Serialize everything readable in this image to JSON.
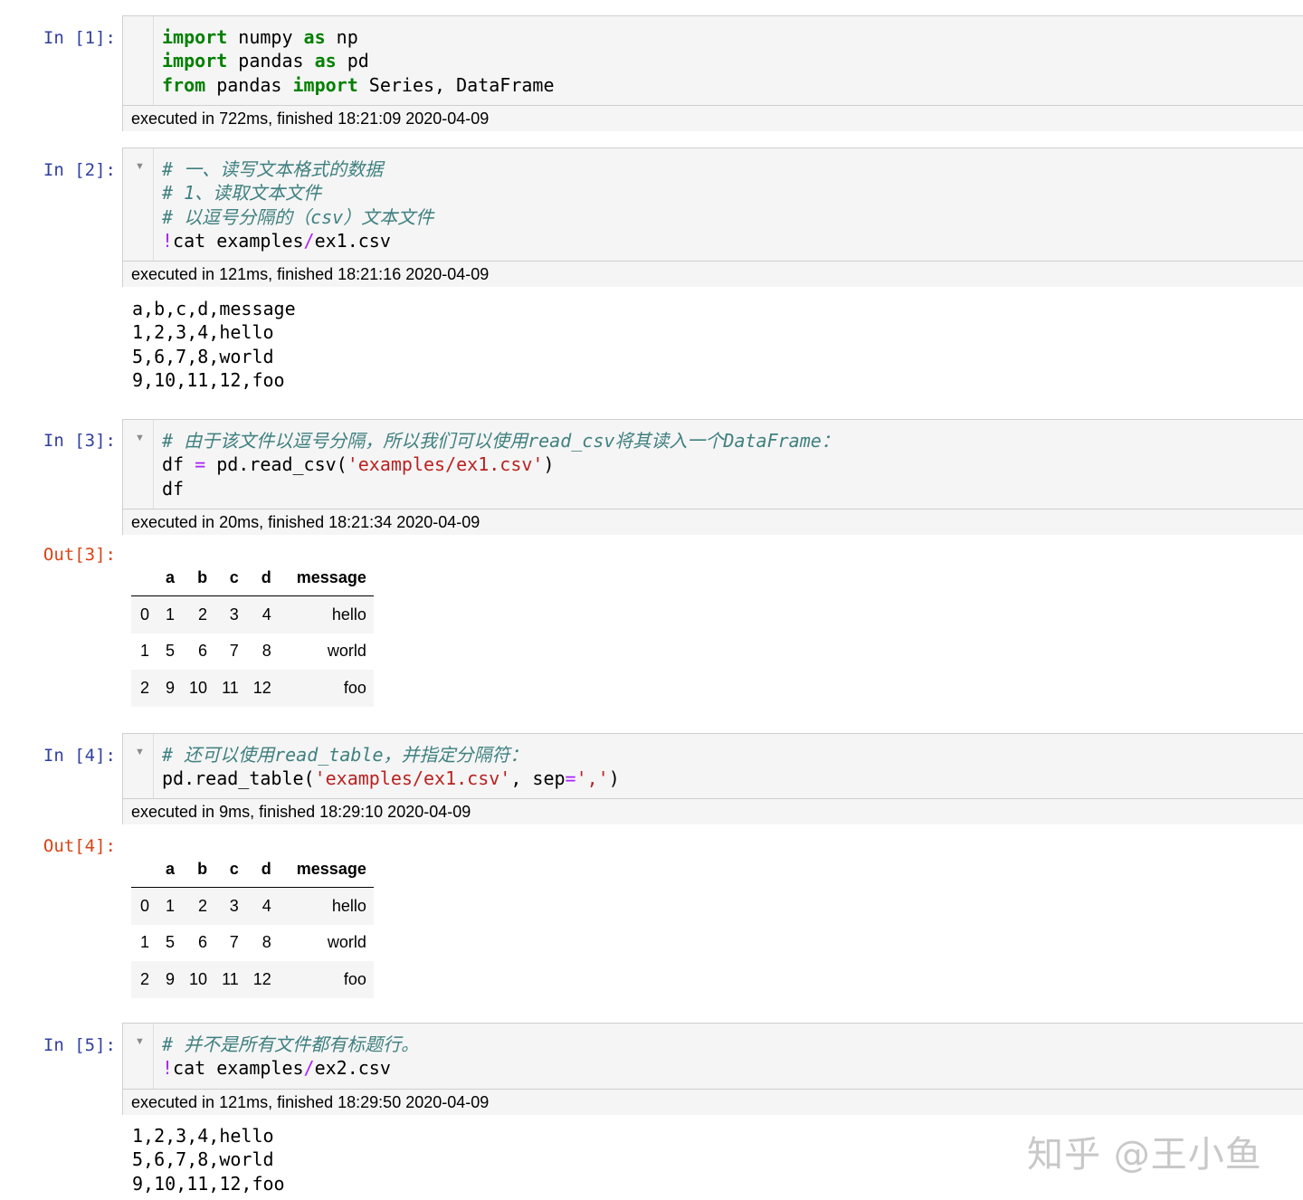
{
  "cells": [
    {
      "prompt": "In [1]:",
      "exec": "executed in 722ms, finished 18:21:09 2020-04-09",
      "code": {
        "l1_k1": "import",
        "l1_t1": " numpy ",
        "l1_k2": "as",
        "l1_t2": " np",
        "l2_k1": "import",
        "l2_t1": " pandas ",
        "l2_k2": "as",
        "l2_t2": " pd",
        "l3_k1": "from",
        "l3_t1": " pandas ",
        "l3_k2": "import",
        "l3_t2": " Series, DataFrame"
      }
    },
    {
      "prompt": "In [2]:",
      "exec": "executed in 121ms, finished 18:21:16 2020-04-09",
      "code": {
        "c1": "# 一、读写文本格式的数据",
        "c2": "# 1、读取文本文件",
        "c3": "# 以逗号分隔的（csv）文本文件",
        "bang": "!",
        "t1": "cat examples",
        "op": "/",
        "t2": "ex1.csv"
      },
      "output_lines": [
        "a,b,c,d,message",
        "1,2,3,4,hello",
        "5,6,7,8,world",
        "9,10,11,12,foo"
      ]
    },
    {
      "prompt": "In [3]:",
      "out_prompt": "Out[3]:",
      "exec": "executed in 20ms, finished 18:21:34 2020-04-09",
      "code": {
        "c1": "# 由于该文件以逗号分隔，所以我们可以使用read_csv将其读入一个DataFrame：",
        "t1": "df ",
        "op": "=",
        "t2": " pd.read_csv(",
        "s1": "'examples/ex1.csv'",
        "t3": ")",
        "l3": "df"
      }
    },
    {
      "prompt": "In [4]:",
      "out_prompt": "Out[4]:",
      "exec": "executed in 9ms, finished 18:29:10 2020-04-09",
      "code": {
        "c1": "# 还可以使用read_table，并指定分隔符：",
        "t1": "pd.read_table(",
        "s1": "'examples/ex1.csv'",
        "t2": ", sep",
        "op": "=",
        "s2": "','",
        "t3": ")"
      }
    },
    {
      "prompt": "In [5]:",
      "exec": "executed in 121ms, finished 18:29:50 2020-04-09",
      "code": {
        "c1": "# 并不是所有文件都有标题行。",
        "bang": "!",
        "t1": "cat examples",
        "op": "/",
        "t2": "ex2.csv"
      },
      "output_lines": [
        "1,2,3,4,hello",
        "5,6,7,8,world",
        "9,10,11,12,foo"
      ]
    }
  ],
  "dataframe": {
    "columns": [
      "",
      "a",
      "b",
      "c",
      "d",
      "message"
    ],
    "rows": [
      [
        "0",
        "1",
        "2",
        "3",
        "4",
        "hello"
      ],
      [
        "1",
        "5",
        "6",
        "7",
        "8",
        "world"
      ],
      [
        "2",
        "9",
        "10",
        "11",
        "12",
        "foo"
      ]
    ]
  },
  "watermark": "知乎 @王小鱼",
  "icons": {
    "collapse": "triangle-down-icon"
  },
  "colors": {
    "in_prompt": "#303f9f",
    "out_prompt": "#d84315",
    "keyword": "#008000",
    "comment": "#408080",
    "string": "#ba2121",
    "operator": "#aa22ff"
  }
}
